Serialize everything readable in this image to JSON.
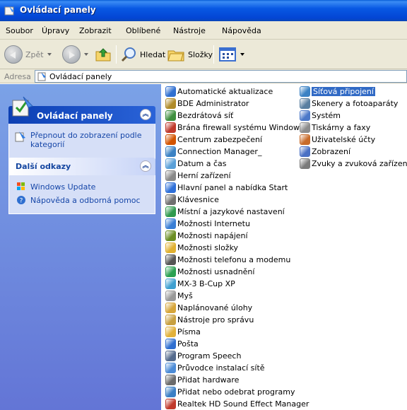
{
  "window": {
    "title": "Ovládací panely"
  },
  "menu": [
    "Soubor",
    "Úpravy",
    "Zobrazit",
    "Oblíbené",
    "Nástroje",
    "Nápověda"
  ],
  "toolbar": {
    "back_label": "Zpět",
    "search_label": "Hledat",
    "folders_label": "Složky"
  },
  "address": {
    "label": "Adresa",
    "value": "Ovládací panely"
  },
  "sidebar": {
    "panel1": {
      "title": "Ovládací panely",
      "link": "Přepnout do zobrazení podle kategorií"
    },
    "panel2": {
      "title": "Další odkazy",
      "links": [
        "Windows Update",
        "Nápověda a odborná pomoc"
      ]
    }
  },
  "items_col1": [
    "Automatické aktualizace",
    "BDE Administrator",
    "Bezdrátová síť",
    "Brána firewall systému Windows",
    "Centrum zabezpečení",
    "Connection Manager_",
    "Datum a čas",
    "Herní zařízení",
    "Hlavní panel a nabídka Start",
    "Klávesnice",
    "Místní a jazykové nastavení",
    "Možnosti Internetu",
    "Možnosti napájení",
    "Možnosti složky",
    "Možnosti telefonu a modemu",
    "Možnosti usnadnění",
    "MX-3 B-Cup XP",
    "Myš",
    "Naplánované úlohy",
    "Nástroje pro správu",
    "Písma",
    "Pošta",
    "Program Speech",
    "Průvodce instalací sítě",
    "Přidat hardware",
    "Přidat nebo odebrat programy",
    "Realtek HD Sound Effect Manager"
  ],
  "items_col2": [
    "Síťová připojení",
    "Skenery a fotoaparáty",
    "Systém",
    "Tiskárny a faxy",
    "Uživatelské účty",
    "Zobrazení",
    "Zvuky a zvuková zařízení"
  ],
  "selected_item": "Síťová připojení",
  "colors": {
    "titlebar": "#0345d4",
    "sidebar_top": "#7ba2e7",
    "sidebar_bottom": "#6375d6",
    "selection": "#316ac5",
    "link": "#1646a8"
  }
}
